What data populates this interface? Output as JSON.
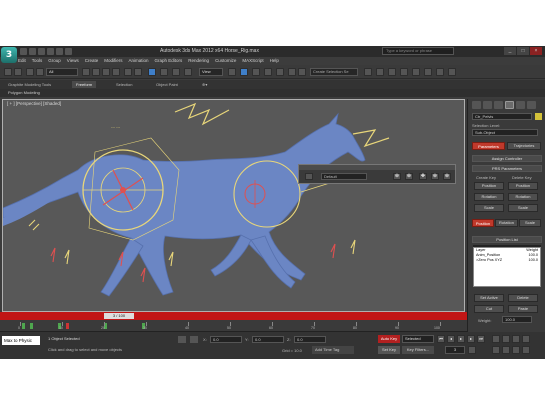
{
  "title_bar": {
    "app_icon_letter": "3",
    "title": "Autodesk 3ds Max 2012 x64    Horse_Rig.max",
    "search_placeholder": "Type a keyword or phrase",
    "window_controls": [
      "_",
      "□",
      "×"
    ]
  },
  "menubar": {
    "items": [
      "Edit",
      "Tools",
      "Group",
      "Views",
      "Create",
      "Modifiers",
      "Animation",
      "Graph Editors",
      "Rendering",
      "Customize",
      "MAXScript",
      "Help"
    ]
  },
  "main_toolbar": {
    "selection_filter": "All",
    "reference_coord": "View",
    "named_selection": "Create Selection Se"
  },
  "ribbon": {
    "tabs": [
      "Graphite Modeling Tools",
      "Freeform",
      "Selection",
      "Object Paint"
    ],
    "active_tab": "Freeform",
    "sub_label": "Polygon Modeling"
  },
  "viewport": {
    "label": "[ + ] [Perspective] [Shaded]",
    "float_field": "Default"
  },
  "command_panel": {
    "object_name": "Ctr_Pelvis",
    "selection_level_label": "Selection Level:",
    "sub_object": "Sub-Object",
    "parameters_btn": "Parameters",
    "trajectories_btn": "Trajectories",
    "assign_controller": "Assign Controller",
    "prs_parameters": "PRS Parameters",
    "create_key": "Create Key",
    "delete_key": "Delete Key",
    "pos_btn": "Position",
    "pos_btn2": "Position",
    "rot_btn": "Rotation",
    "rot_btn2": "Rotation",
    "scale_btn": "Scale",
    "scale_btn2": "Scale",
    "position_btn": "Position",
    "rotation_btn": "Rotation",
    "scale_tab": "Scale",
    "position_list_rollout": "Position List",
    "list_headers": [
      "Layer",
      "Weight"
    ],
    "list_rows": [
      {
        "name": "Anim_Position",
        "weight": "100.0"
      },
      {
        "name": ">Zero Pos XYZ",
        "weight": "100.0"
      }
    ],
    "set_active": "Set Active",
    "delete": "Delete",
    "cut": "Cut",
    "paste": "Paste",
    "weight_label": "Weight:",
    "weight_value": "100.0"
  },
  "time_slider": {
    "current": "3 / 100",
    "tick_labels": [
      "0",
      "10",
      "20",
      "30",
      "40",
      "50",
      "60",
      "70",
      "80",
      "90",
      "100"
    ]
  },
  "status_bar": {
    "maxscript_text": "Max to Physic",
    "status_line1": "1 Object Selected",
    "status_line2": "Click and drag to select and move objects",
    "x_label": "X:",
    "x_value": "0.0",
    "y_label": "Y:",
    "y_value": "0.0",
    "z_label": "Z:",
    "z_value": "0.0",
    "grid_text": "Grid = 10.0",
    "add_time_tag": "Add Time Tag",
    "auto_key": "Auto Key",
    "selected": "Selected",
    "set_key": "Set Key",
    "key_filters": "Key Filters...",
    "frame": "3"
  },
  "colors": {
    "viewport_bg": "#585858",
    "horse": "#6b86c4",
    "gizmo_yellow": "#e8d67a",
    "gizmo_red": "#e05050",
    "time_slider": "#c11616",
    "accent_blue": "#3f7fc9"
  }
}
